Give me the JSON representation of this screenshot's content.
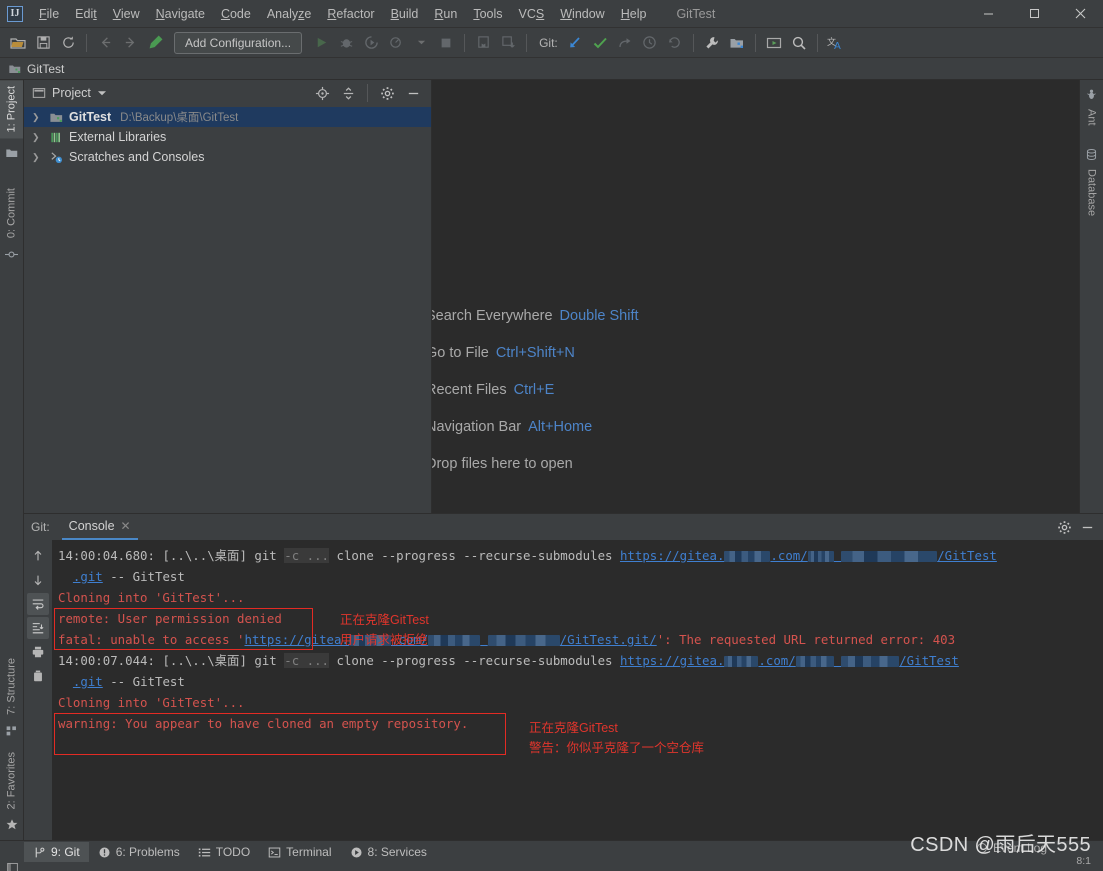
{
  "window": {
    "title": "GitTest",
    "minimize_label": "–",
    "maximize_label": "□",
    "close_label": "✕"
  },
  "menubar": {
    "items": [
      {
        "label": "File",
        "mnemonic": "F"
      },
      {
        "label": "Edit",
        "mnemonic": "E"
      },
      {
        "label": "View",
        "mnemonic": "V"
      },
      {
        "label": "Navigate",
        "mnemonic": "N"
      },
      {
        "label": "Code",
        "mnemonic": "C"
      },
      {
        "label": "Analyze",
        "mnemonic": "z"
      },
      {
        "label": "Refactor",
        "mnemonic": "R"
      },
      {
        "label": "Build",
        "mnemonic": "B"
      },
      {
        "label": "Run",
        "mnemonic": "R"
      },
      {
        "label": "Tools",
        "mnemonic": "T"
      },
      {
        "label": "VCS",
        "mnemonic": "S"
      },
      {
        "label": "Window",
        "mnemonic": "W"
      },
      {
        "label": "Help",
        "mnemonic": "H"
      }
    ]
  },
  "toolbar": {
    "run_config_label": "Add Configuration...",
    "git_label": "Git:",
    "icons": [
      "open-folder-icon",
      "save-all-icon",
      "sync-icon",
      "back-icon",
      "forward-icon",
      "build-icon",
      "run-icon",
      "debug-icon",
      "run-coverage-icon",
      "profile-icon",
      "stop-icon",
      "bookmark-icon",
      "update-project-icon",
      "git-update-icon",
      "git-commit-icon",
      "git-push-icon",
      "git-history-icon",
      "git-rollback-icon",
      "settings-wrench-icon",
      "project-structure-icon",
      "select-in-icon",
      "search-everywhere-icon",
      "translate-icon"
    ]
  },
  "navbar": {
    "project_name": "GitTest",
    "icon": "module-icon"
  },
  "left_strip": {
    "tabs": [
      {
        "label": "1: Project",
        "mnemonic": "1",
        "icon": "project-icon",
        "active": true
      },
      {
        "label": "0: Commit",
        "mnemonic": "0",
        "icon": "commit-icon",
        "active": false
      },
      {
        "label": "7: Structure",
        "mnemonic": "7",
        "icon": "structure-icon",
        "active": false
      },
      {
        "label": "2: Favorites",
        "mnemonic": "2",
        "icon": "star-icon",
        "active": false
      }
    ]
  },
  "right_strip": {
    "tabs": [
      {
        "label": "Ant",
        "icon": "ant-icon"
      },
      {
        "label": "Database",
        "icon": "database-icon"
      }
    ]
  },
  "project_panel": {
    "title": "Project",
    "dropdown_icon": "chevron-down-icon",
    "header_icons": [
      "locate-target-icon",
      "collapse-all-icon",
      "gear-icon",
      "hide-icon"
    ],
    "tree": [
      {
        "label": "GitTest",
        "path": "D:\\Backup\\桌面\\GitTest",
        "icon": "module-icon",
        "selected": true,
        "expander": "❯"
      },
      {
        "label": "External Libraries",
        "path": "",
        "icon": "library-icon",
        "selected": false,
        "expander": "❯"
      },
      {
        "label": "Scratches and Consoles",
        "path": "",
        "icon": "scratches-icon",
        "selected": false,
        "expander": "❯"
      }
    ]
  },
  "editor": {
    "hints": [
      {
        "action": "Search Everywhere",
        "shortcut": "Double Shift"
      },
      {
        "action": "Go to File",
        "shortcut": "Ctrl+Shift+N"
      },
      {
        "action": "Recent Files",
        "shortcut": "Ctrl+E"
      },
      {
        "action": "Navigation Bar",
        "shortcut": "Alt+Home"
      },
      {
        "action": "Drop files here to open",
        "shortcut": ""
      }
    ]
  },
  "console_window": {
    "tool_label": "Git:",
    "tab_label": "Console",
    "tab_close_icon": "close-icon",
    "header_icons": [
      "gear-icon",
      "hide-icon"
    ],
    "gutter_icons": [
      {
        "name": "scroll-up-icon",
        "glyph": "↑",
        "active": false
      },
      {
        "name": "scroll-down-icon",
        "glyph": "↓",
        "active": false
      },
      {
        "name": "soft-wrap-icon",
        "glyph": "",
        "active": true
      },
      {
        "name": "scroll-to-end-icon",
        "glyph": "",
        "active": true
      },
      {
        "name": "print-icon",
        "glyph": "",
        "active": false
      },
      {
        "name": "clear-all-icon",
        "glyph": "",
        "active": false
      }
    ],
    "lines": [
      {
        "id": "cmd1",
        "timestamp": "14:00:04.680:",
        "cwd": "[..\\..\\桌面]",
        "cmd": "git",
        "redacted_flag": "-c ...",
        "args": "clone --progress --recurse-submodules",
        "url_prefix": "https://gitea.",
        "url_mid": ".com/",
        "url_suffix": "/GitTest"
      },
      {
        "id": "cont1",
        "text": ".git -- GitTest",
        "link_part": ".git"
      },
      {
        "id": "out1",
        "text": "Cloning into 'GitTest'...",
        "style": "error"
      },
      {
        "id": "out2",
        "text": "remote: User permission denied",
        "style": "error"
      },
      {
        "id": "fatal",
        "prefix": "fatal: unable to access '",
        "url_prefix": "https://gitea.",
        "url_mid": ".com/",
        "url_suffix": "/GitTest.git/",
        "suffix": "': The requested URL returned error: 403",
        "style": "error"
      },
      {
        "id": "cmd2",
        "timestamp": "14:00:07.044:",
        "cwd": "[..\\..\\桌面]",
        "cmd": "git",
        "redacted_flag": "-c ...",
        "args": "clone --progress --recurse-submodules",
        "url_prefix": "https://gitea.",
        "url_mid": ".com/",
        "url_suffix": "/GitTest"
      },
      {
        "id": "cont2",
        "text": ".git -- GitTest",
        "link_part": ".git"
      },
      {
        "id": "out3",
        "text": "Cloning into 'GitTest'...",
        "style": "error"
      },
      {
        "id": "out4",
        "text": "warning: You appear to have cloned an empty repository.",
        "style": "error"
      }
    ],
    "annotations": [
      {
        "id": "note1",
        "line1": "正在克隆GitTest",
        "line2": "用户请求被拒绝"
      },
      {
        "id": "note2",
        "line1": "正在克隆GitTest",
        "line2": "警告：你似乎克隆了一个空仓库"
      }
    ]
  },
  "statusbar": {
    "tool_buttons": [
      {
        "label": "9: Git",
        "mnemonic": "9",
        "icon": "git-branch-icon",
        "active": true
      },
      {
        "label": "6: Problems",
        "mnemonic": "6",
        "icon": "problems-icon",
        "active": false
      },
      {
        "label": "TODO",
        "mnemonic": "",
        "icon": "todo-icon",
        "active": false
      },
      {
        "label": "Terminal",
        "mnemonic": "",
        "icon": "terminal-icon",
        "active": false
      },
      {
        "label": "8: Services",
        "mnemonic": "8",
        "icon": "services-icon",
        "active": false
      }
    ],
    "event_log": "Event Log",
    "caret_position": "8:1",
    "watermark": "CSDN @雨后天555"
  },
  "colors": {
    "toolbar_bg": "#3c3f41",
    "editor_bg": "#2b2b2b",
    "selection_blue": "#1f3a5f",
    "accent_blue": "#4d84c8",
    "error_red": "#d4534e",
    "annotation_red": "#e0352c",
    "link_blue": "#3f7fd0"
  }
}
